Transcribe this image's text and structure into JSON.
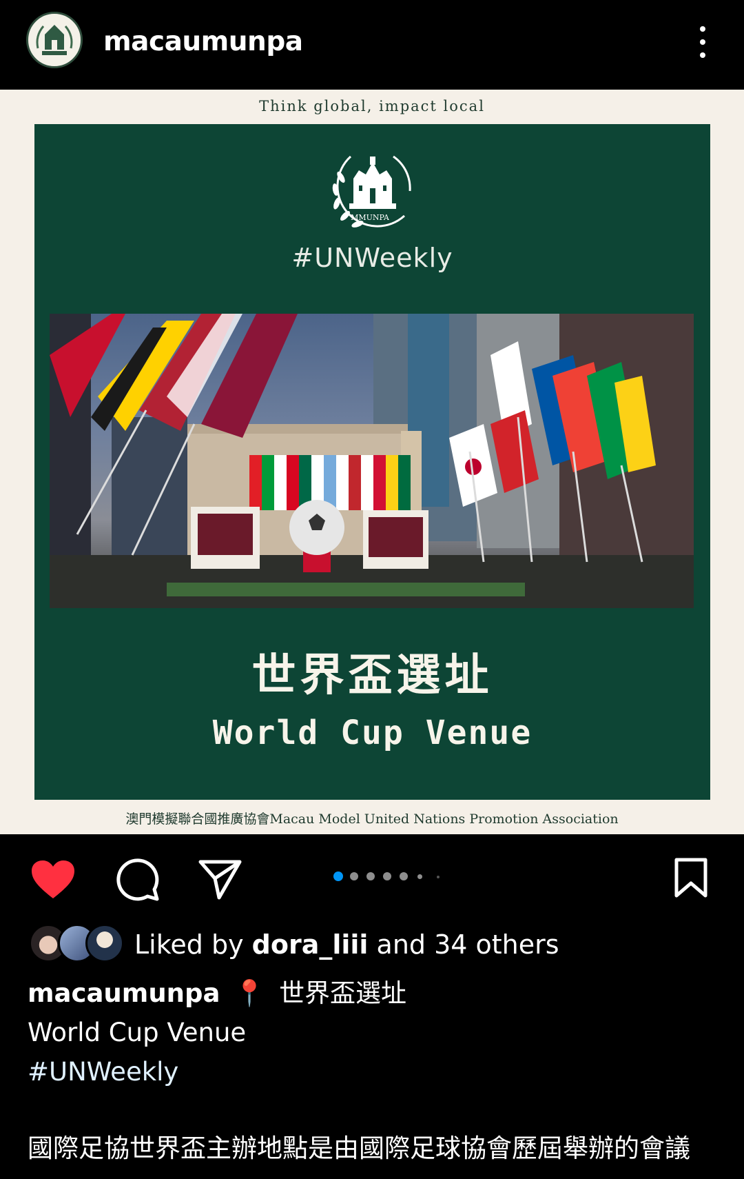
{
  "header": {
    "username": "macaumunpa",
    "avatar_icon": "mmunpa-logo-icon",
    "more_icon": "more-vertical-icon"
  },
  "post_image": {
    "tagline": "Think global, impact local",
    "logo_text": "MMUNPA",
    "hashtag": "#UNWeekly",
    "title_zh": "世界盃選址",
    "title_en": "World Cup Venue",
    "footer": "澳門模擬聯合國推廣協會Macau Model United Nations Promotion Association",
    "panel_color": "#0d4535",
    "background_color": "#f5f0e8"
  },
  "actions": {
    "like_icon": "heart-filled-icon",
    "like_color": "#ff3040",
    "comment_icon": "comment-icon",
    "share_icon": "paper-plane-icon",
    "save_icon": "bookmark-icon",
    "carousel": {
      "total_dots": 7,
      "active_index": 0,
      "active_color": "#0095f6"
    }
  },
  "likes": {
    "prefix": "Liked by ",
    "user": "dora_liii",
    "suffix": " and 34 others"
  },
  "caption": {
    "user": "macaumunpa",
    "pin": "📍",
    "title_zh": "世界盃選址",
    "title_en": "World Cup Venue",
    "hashtag": "#UNWeekly",
    "body": "國際足協世界盃主辦地點是由國際足球協會歷屆舉辦的會議"
  }
}
